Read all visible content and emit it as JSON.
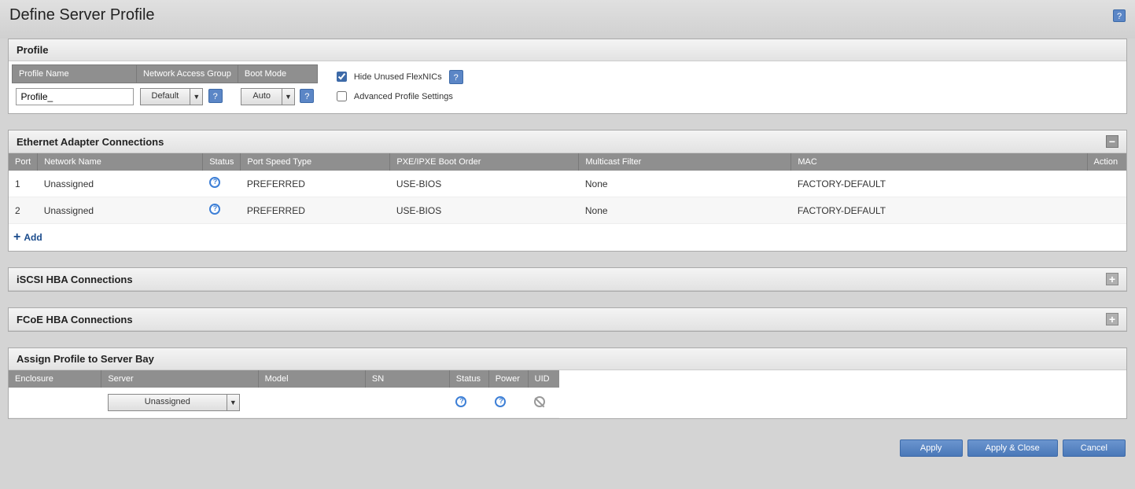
{
  "page": {
    "title": "Define Server Profile"
  },
  "profile": {
    "header": "Profile",
    "labels": {
      "profile_name": "Profile Name",
      "network_access_group": "Network Access Group",
      "boot_mode": "Boot Mode"
    },
    "values": {
      "profile_name": "Profile_",
      "network_access_group": "Default",
      "boot_mode": "Auto"
    },
    "checkboxes": {
      "hide_unused": {
        "label": "Hide Unused FlexNICs",
        "checked": true
      },
      "advanced": {
        "label": "Advanced Profile Settings",
        "checked": false
      }
    }
  },
  "ethernet": {
    "header": "Ethernet Adapter Connections",
    "columns": {
      "port": "Port",
      "network_name": "Network Name",
      "status": "Status",
      "port_speed_type": "Port Speed Type",
      "pxe": "PXE/IPXE Boot Order",
      "multicast": "Multicast Filter",
      "mac": "MAC",
      "action": "Action"
    },
    "rows": [
      {
        "port": "1",
        "network_name": "Unassigned",
        "port_speed_type": "PREFERRED",
        "pxe": "USE-BIOS",
        "multicast": "None",
        "mac": "FACTORY-DEFAULT"
      },
      {
        "port": "2",
        "network_name": "Unassigned",
        "port_speed_type": "PREFERRED",
        "pxe": "USE-BIOS",
        "multicast": "None",
        "mac": "FACTORY-DEFAULT"
      }
    ],
    "add_label": "Add"
  },
  "iscsi": {
    "header": "iSCSI HBA Connections"
  },
  "fcoe": {
    "header": "FCoE HBA Connections"
  },
  "assign": {
    "header": "Assign Profile to Server Bay",
    "columns": {
      "enclosure": "Enclosure",
      "server": "Server",
      "model": "Model",
      "sn": "SN",
      "status": "Status",
      "power": "Power",
      "uid": "UID"
    },
    "server_value": "Unassigned"
  },
  "footer": {
    "apply": "Apply",
    "apply_close": "Apply & Close",
    "cancel": "Cancel"
  }
}
